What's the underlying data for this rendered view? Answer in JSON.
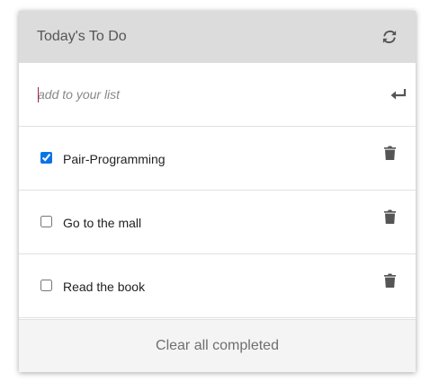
{
  "header": {
    "title": "Today's To Do",
    "refresh_icon": "refresh-icon"
  },
  "input": {
    "placeholder": "add to your list",
    "value": "",
    "submit_icon": "enter-return-icon"
  },
  "todos": [
    {
      "label": "Pair-Programming",
      "completed": true
    },
    {
      "label": "Go to the mall",
      "completed": false
    },
    {
      "label": "Read the book",
      "completed": false
    }
  ],
  "footer": {
    "clear_label": "Clear all completed"
  },
  "colors": {
    "header_bg": "#dcdcdc",
    "footer_bg": "#f4f4f4",
    "checkbox_accent": "#0b74e5",
    "icon": "#555555"
  }
}
